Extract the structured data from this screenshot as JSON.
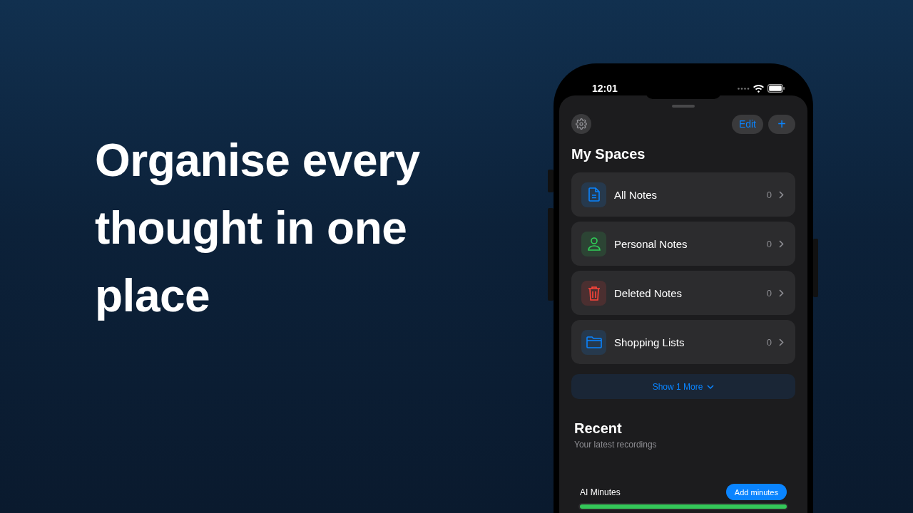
{
  "headline": "Organise every thought in one place",
  "status_bar": {
    "time": "12:01"
  },
  "header": {
    "edit_label": "Edit",
    "add_label": "+"
  },
  "spaces": {
    "title": "My Spaces",
    "items": [
      {
        "kind": "document",
        "label": "All Notes",
        "count": "0",
        "color": "#0a84ff"
      },
      {
        "kind": "person",
        "label": "Personal Notes",
        "count": "0",
        "color": "#30d158"
      },
      {
        "kind": "trash",
        "label": "Deleted Notes",
        "count": "0",
        "color": "#ff453a"
      },
      {
        "kind": "folder",
        "label": "Shopping Lists",
        "count": "0",
        "color": "#0a84ff"
      }
    ],
    "show_more": "Show 1 More"
  },
  "recent": {
    "title": "Recent",
    "subtitle": "Your latest recordings"
  },
  "ai_minutes": {
    "label": "AI Minutes",
    "button": "Add minutes",
    "level": 1
  }
}
